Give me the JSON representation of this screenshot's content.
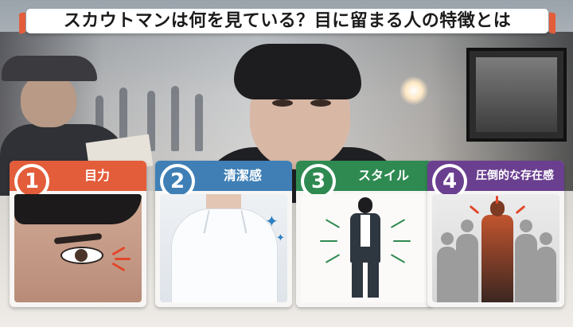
{
  "title": "スカウトマンは何を見ている？目に留まる人の特徴とは",
  "colors": {
    "accent_orange": "#e35d3b",
    "card1": "#e35d3b",
    "card2": "#3f7fb6",
    "card3": "#2f8a52",
    "card4": "#6a3f8f"
  },
  "cards": [
    {
      "number": "1",
      "label": "目力",
      "icon": "eye-closeup"
    },
    {
      "number": "2",
      "label": "清潔感",
      "icon": "white-shirt-sparkle"
    },
    {
      "number": "3",
      "label": "スタイル",
      "icon": "standing-figure"
    },
    {
      "number": "4",
      "label": "圧倒的な存在感",
      "icon": "standout-figure"
    }
  ]
}
